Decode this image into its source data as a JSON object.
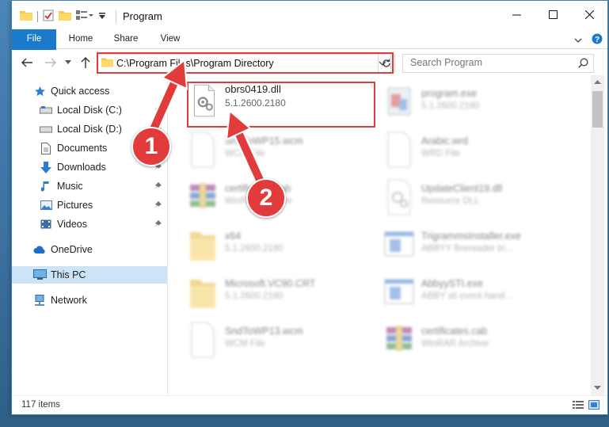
{
  "window": {
    "title": "Program"
  },
  "ribbon": {
    "tabs": [
      "File",
      "Home",
      "Share",
      "View"
    ]
  },
  "address": {
    "path": "C:\\Program Files\\Program Directory"
  },
  "search": {
    "placeholder": "Search Program"
  },
  "sidebar": {
    "items": [
      {
        "label": "Quick access",
        "icon": "star-icon"
      },
      {
        "label": "Local Disk (C:)",
        "icon": "drive-icon"
      },
      {
        "label": "Local Disk (D:)",
        "icon": "drive-icon"
      },
      {
        "label": "Documents",
        "icon": "documents-icon"
      },
      {
        "label": "Downloads",
        "icon": "download-icon"
      },
      {
        "label": "Music",
        "icon": "music-icon"
      },
      {
        "label": "Pictures",
        "icon": "pictures-icon"
      },
      {
        "label": "Videos",
        "icon": "videos-icon"
      },
      {
        "label": "OneDrive",
        "icon": "cloud-icon"
      },
      {
        "label": "This PC",
        "icon": "computer-icon"
      },
      {
        "label": "Network",
        "icon": "network-icon"
      }
    ]
  },
  "files": [
    {
      "name": "obrs0419.dll",
      "sub": "5.1.2600.2180",
      "icon": "dll-icon"
    },
    {
      "name": "program.exe",
      "sub": "5.1.2600.2180",
      "icon": "exe-icon"
    },
    {
      "name": "SndToWP15.wcm",
      "sub": "WCM File",
      "icon": "blank-file-icon"
    },
    {
      "name": "Arabic.wrd",
      "sub": "WRD File",
      "icon": "blank-file-icon"
    },
    {
      "name": "certificates.cab",
      "sub": "WinRAR Archive",
      "icon": "winrar-icon"
    },
    {
      "name": "UpdateClient19.dll",
      "sub": "Resource DLL",
      "icon": "dll-icon"
    },
    {
      "name": "x64",
      "sub": "5.1.2600.2180",
      "icon": "folder-icon"
    },
    {
      "name": "TrigrammsInstaller.exe",
      "sub": "ABBYY finereader tri...",
      "icon": "app-window-icon"
    },
    {
      "name": "Microsoft.VC90.CRT",
      "sub": "5.1.2600.2180",
      "icon": "folder-icon"
    },
    {
      "name": "AbbyySTI.exe",
      "sub": "ABBY sti event hand...",
      "icon": "app-window-icon"
    },
    {
      "name": "SndToWP13.wcm",
      "sub": "WCM File",
      "icon": "blank-file-icon"
    },
    {
      "name": "certificates.cab",
      "sub": "WinRAR Archive",
      "icon": "winrar-icon"
    }
  ],
  "status": {
    "items_count": "117 items"
  },
  "annotations": {
    "step1": "1",
    "step2": "2"
  },
  "colors": {
    "accent": "#1979ca",
    "highlight": "#e23b3b",
    "selected": "#cce4f7"
  }
}
